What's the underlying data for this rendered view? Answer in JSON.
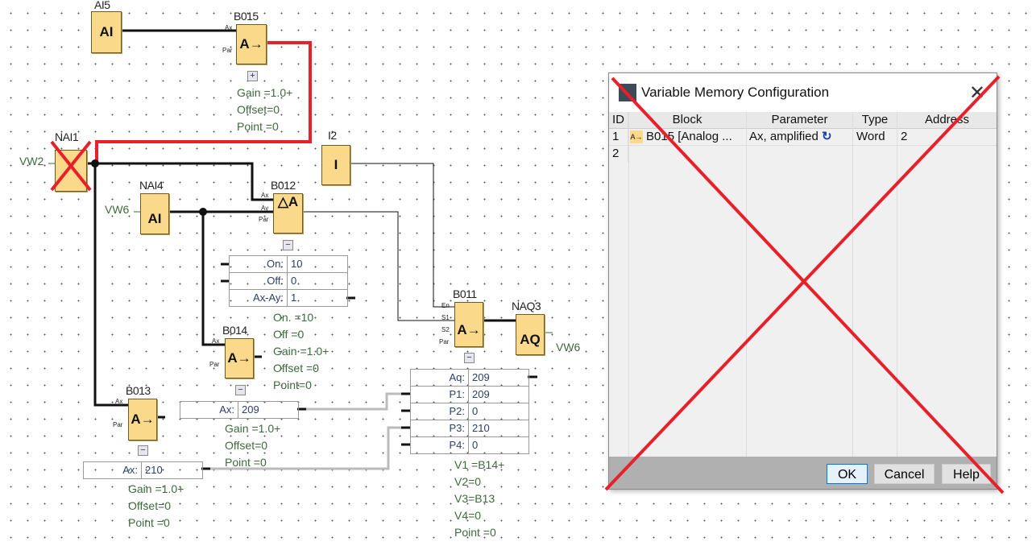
{
  "diagram": {
    "blocks": {
      "ai5": {
        "name": "AI5",
        "symbol": "AI"
      },
      "b015": {
        "name": "B015",
        "symbol": "A→",
        "params": [
          "Gain  =1.0+",
          "Offset=0",
          "Point =0"
        ],
        "toggle": "+"
      },
      "nai1": {
        "name": "NAI1",
        "var": "VW2"
      },
      "i2": {
        "name": "I2",
        "symbol": "I"
      },
      "nai4": {
        "name": "NAI4",
        "symbol": "AI",
        "var": "VW6"
      },
      "b012": {
        "name": "B012",
        "symbol": "△A",
        "toggle": "−",
        "params": [
          "On.   =10",
          "Off   =0",
          "Gain   =1.0+",
          "Offset =0",
          "Point=0"
        ]
      },
      "b014": {
        "name": "B014",
        "symbol": "A→",
        "toggle": "−",
        "params": [
          "Gain  =1.0+",
          "Offset=0",
          "Point =0"
        ]
      },
      "b011": {
        "name": "B011",
        "symbol": "A→",
        "toggle": "−",
        "params": [
          "V1  =B14+",
          "V2=0",
          "V3=B13",
          "V4=0",
          "Point =0"
        ]
      },
      "naq3": {
        "name": "NAQ3",
        "symbol": "AQ",
        "var": "VW6"
      },
      "b013": {
        "name": "B013",
        "symbol": "A→",
        "toggle": "−",
        "params": [
          "Gain  =1.0+",
          "Offset=0",
          "Point =0"
        ]
      }
    },
    "tables": {
      "b012": [
        {
          "k": "On:",
          "v": "10"
        },
        {
          "k": "Off:",
          "v": "0"
        },
        {
          "k": "Ax-Ay:",
          "v": "1"
        }
      ],
      "b011": [
        {
          "k": "Aq:",
          "v": "209"
        },
        {
          "k": "P1:",
          "v": "209"
        },
        {
          "k": "P2:",
          "v": "0"
        },
        {
          "k": "P3:",
          "v": "210"
        },
        {
          "k": "P4:",
          "v": "0"
        }
      ],
      "b014": [
        {
          "k": "Ax:",
          "v": "209"
        }
      ],
      "b013": [
        {
          "k": "Ax:",
          "v": "210"
        }
      ]
    },
    "pins": {
      "ax": "Ax",
      "ay": "Ay",
      "par": "Par",
      "en": "En",
      "s1": "S1",
      "s2": "S2"
    },
    "colors": {
      "block": "#fbd98a",
      "highlight_wire": "#e8202a",
      "param_text": "#3c6a3c"
    }
  },
  "dialog": {
    "title": "Variable Memory Configuration",
    "columns": [
      "ID",
      "Block",
      "Parameter",
      "Type",
      "Address"
    ],
    "rows": [
      {
        "id": "1",
        "block": "B015 [Analog ...",
        "parameter": "Ax, amplified",
        "type": "Word",
        "address": "2"
      },
      {
        "id": "2",
        "block": "",
        "parameter": "",
        "type": "",
        "address": ""
      }
    ],
    "buttons": {
      "ok": "OK",
      "cancel": "Cancel",
      "help": "Help"
    }
  }
}
